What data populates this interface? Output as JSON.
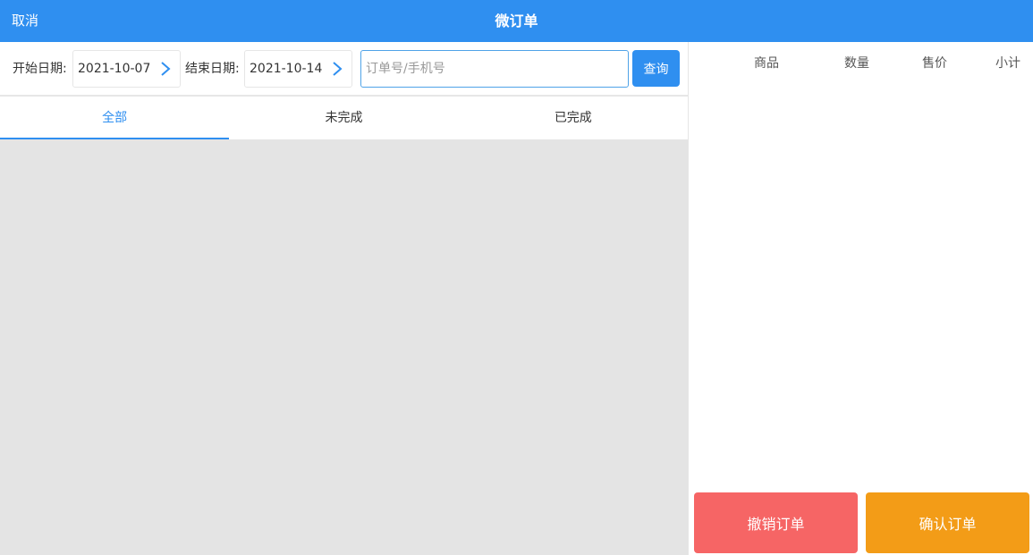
{
  "header": {
    "cancel_label": "取消",
    "title": "微订单"
  },
  "filter": {
    "start_label": "开始日期:",
    "start_value": "2021-10-07",
    "end_label": "结束日期:",
    "end_value": "2021-10-14",
    "search_placeholder": "订单号/手机号",
    "search_value": "",
    "query_label": "查询"
  },
  "tabs": [
    {
      "label": "全部",
      "active": true
    },
    {
      "label": "未完成",
      "active": false
    },
    {
      "label": "已完成",
      "active": false
    }
  ],
  "detail": {
    "columns": [
      "商品",
      "数量",
      "售价",
      "小计"
    ],
    "revoke_label": "撤销订单",
    "confirm_label": "确认订单"
  },
  "colors": {
    "primary": "#2f8ff0",
    "revoke": "#f66565",
    "confirm": "#f39c17",
    "list_bg": "#e4e4e4"
  },
  "icons": [
    "chevron-right-icon"
  ]
}
